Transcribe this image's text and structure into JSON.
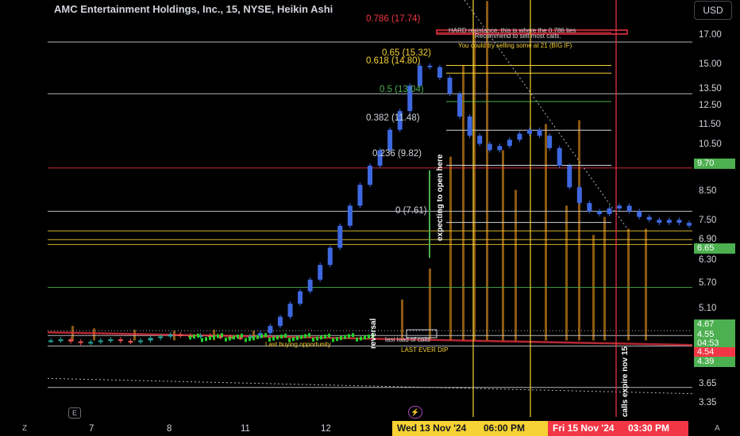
{
  "header": {
    "title": "AMC Entertainment Holdings, Inc., 15, NYSE, Heikin Ashi",
    "currency_button": "USD"
  },
  "chart_data": {
    "type": "candlestick",
    "style": "Heikin Ashi",
    "symbol": "AMC",
    "interval": "15",
    "exchange": "NYSE",
    "y_axis": {
      "ticks": [
        "17.00",
        "15.00",
        "13.50",
        "12.50",
        "11.50",
        "10.50",
        "9.70",
        "8.50",
        "7.50",
        "6.90",
        "6.65",
        "6.30",
        "5.70",
        "5.10",
        "4.67",
        "4.55",
        "04:53",
        "4.54",
        "4.39",
        "3.65",
        "3.35"
      ],
      "ylim": [
        3.2,
        20.5
      ],
      "scale": "log"
    },
    "x_axis": {
      "ticks": [
        "7",
        "8",
        "11",
        "12",
        "Wed 13 Nov '24",
        "06:00 PM",
        "Fri 15 Nov '24",
        "03:30 PM",
        "A"
      ]
    },
    "price_labels": [
      {
        "value": "9.70",
        "color": "#4caf50"
      },
      {
        "value": "6.65",
        "color": "#4caf50"
      },
      {
        "value": "4.67",
        "color": "#4caf50"
      },
      {
        "value": "4.55",
        "color": "#4caf50"
      },
      {
        "value": "04:53",
        "color": "#4caf50"
      },
      {
        "value": "4.54",
        "color": "#f23645"
      },
      {
        "value": "4.39",
        "color": "#4caf50"
      }
    ],
    "fib_levels": [
      {
        "label": "0.786 (17.74)",
        "value": 17.74,
        "color": "#f23645"
      },
      {
        "label": "0.65 (15.32)",
        "value": 15.32,
        "color": "#f7d234"
      },
      {
        "label": "0.618 (14.80)",
        "value": 14.8,
        "color": "#f7d234"
      },
      {
        "label": "0.5 (13.04)",
        "value": 13.04,
        "color": "#4caf50"
      },
      {
        "label": "0.382 (11.48)",
        "value": 11.48,
        "color": "#d1d4dc"
      },
      {
        "label": "0.236 (9.82)",
        "value": 9.82,
        "color": "#d1d4dc"
      },
      {
        "label": "0 (7.61)",
        "value": 7.61,
        "color": "#d1d4dc"
      }
    ],
    "horizontal_lines": [
      {
        "value": 17.0,
        "color": "#d1d4dc"
      },
      {
        "value": 13.5,
        "color": "#d1d4dc"
      },
      {
        "value": 9.7,
        "color": "#f23645"
      },
      {
        "value": 8.0,
        "color": "#d1d4dc"
      },
      {
        "value": 7.33,
        "color": "#f7d234"
      },
      {
        "value": 7.05,
        "color": "#f7d234"
      },
      {
        "value": 6.9,
        "color": "#f7d234"
      },
      {
        "value": 5.7,
        "color": "#4caf50"
      },
      {
        "value": 4.6,
        "color": "#d1d4dc"
      },
      {
        "value": 4.39,
        "color": "#d1d4dc"
      },
      {
        "value": 3.65,
        "color": "#d1d4dc"
      }
    ],
    "vertical_markers": [
      {
        "label": "Wed 13 Nov '24",
        "color": "#f7d234"
      },
      {
        "label": "06:00 PM",
        "color": "#f7d234"
      },
      {
        "label": "Fri 15 Nov '24",
        "color": "#f23645"
      }
    ],
    "series": [
      {
        "name": "price",
        "values": [
          4.5,
          4.52,
          4.48,
          4.45,
          4.47,
          4.5,
          4.52,
          4.49,
          4.47,
          4.5,
          4.55,
          4.58,
          4.62,
          4.6,
          4.58,
          4.6,
          4.58,
          4.57,
          4.56,
          4.55,
          4.58,
          4.65,
          4.8,
          5.0,
          5.3,
          5.6,
          5.9,
          6.3,
          6.8,
          7.5,
          8.2,
          9.0,
          9.8,
          10.5,
          11.5,
          12.5,
          14.0,
          15.3,
          15.2,
          14.5,
          13.5,
          12.2,
          11.2,
          10.8,
          10.5,
          10.7,
          11.0,
          11.3,
          11.5,
          11.2,
          10.6,
          9.8,
          8.9,
          8.3,
          8.0,
          7.9,
          8.1,
          8.2,
          8.0,
          7.8,
          7.7,
          7.6,
          7.7,
          7.6,
          7.5
        ]
      }
    ],
    "annotations": {
      "hard_resistance": "HARD resistance, this is where the 0.786 lies",
      "recommend": "Recommend to sell most calls.",
      "try_selling": "You could try selling some at 21  (BIG IF)",
      "expecting": "expecting to open here",
      "last_buying": "Last buying opportunity",
      "reversal": "reversal",
      "last_load": "last load of calls",
      "last_dip": "LAST EVER DIP",
      "calls_expire": "calls expire nov 15"
    }
  },
  "bottom_bar": {
    "left": "Z",
    "right": "A"
  }
}
